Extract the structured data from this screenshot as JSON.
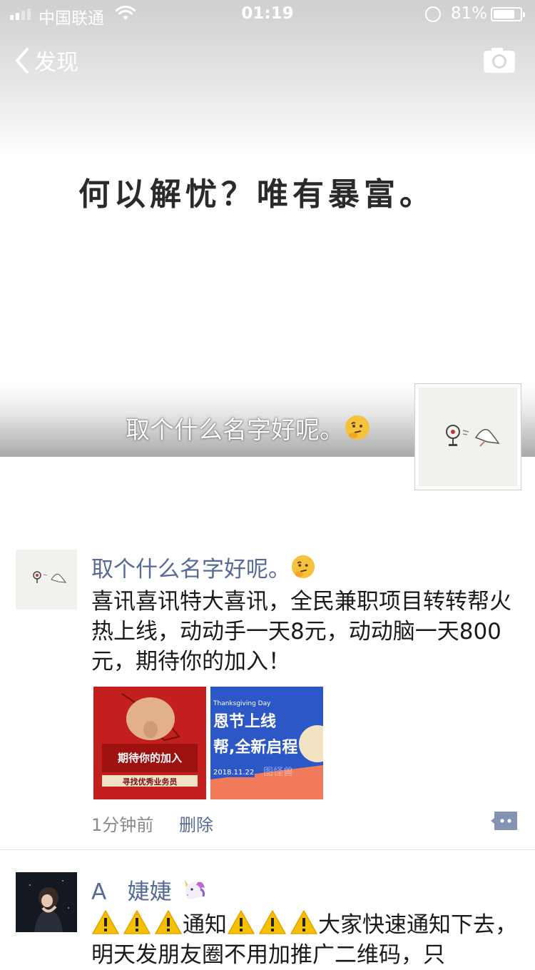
{
  "status_bar": {
    "carrier": "中国联通",
    "time": "01:19",
    "battery_percent": "81%",
    "battery_level": 0.81
  },
  "nav": {
    "back_label": "发现"
  },
  "cover": {
    "text": "何以解忧？唯有暴富。"
  },
  "profile": {
    "name": "取个什么名字好呢。"
  },
  "posts": [
    {
      "name": "取个什么名字好呢。",
      "text": "喜讯喜讯特大喜讯，全民兼职项目转转帮火热上线，动动手一天8元，动动脑一天800元，期待你的加入！",
      "images": [
        {
          "headline": "期待你的加入",
          "banner": "寻找优秀业务员"
        },
        {
          "en": "Thanksgiving Day",
          "line1": "恩节上线",
          "line2": "帮,全新启程",
          "date": "2018.11.22",
          "watermark": "图怪兽"
        }
      ],
      "time": "1分钟前",
      "delete_label": "删除"
    },
    {
      "name": "A   婕婕",
      "text_part1": "通知",
      "text_part2": "大家快速通知下去，明天发朋友圈不用加推广二维码，只"
    }
  ],
  "colors": {
    "link": "#576b95",
    "text": "#1a1a1a",
    "meta": "#8a8a8a"
  }
}
